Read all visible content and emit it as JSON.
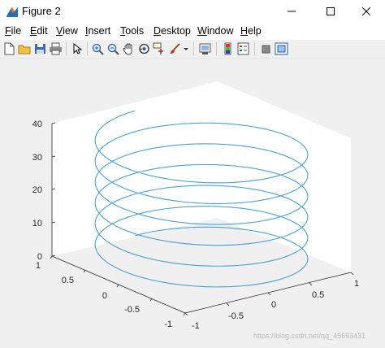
{
  "window": {
    "title": "Figure 2",
    "icon": "matlab-figure-icon",
    "controls": [
      "minimize-icon",
      "maximize-icon",
      "close-icon"
    ]
  },
  "menu": [
    {
      "label": "File",
      "key": "F"
    },
    {
      "label": "Edit",
      "key": "E"
    },
    {
      "label": "View",
      "key": "V"
    },
    {
      "label": "Insert",
      "key": "I"
    },
    {
      "label": "Tools",
      "key": "T"
    },
    {
      "label": "Desktop",
      "key": "D"
    },
    {
      "label": "Window",
      "key": "W"
    },
    {
      "label": "Help",
      "key": "H"
    }
  ],
  "toolbar": [
    "new-figure-icon",
    "open-file-icon",
    "save-icon",
    "print-icon",
    "edit-plot-arrow-icon",
    "zoom-in-icon",
    "zoom-out-icon",
    "pan-hand-icon",
    "rotate-3d-icon",
    "data-cursor-icon",
    "brush-icon",
    "brush-dropdown-icon",
    "link-plot-icon",
    "insert-colorbar-icon",
    "insert-legend-icon",
    "hide-plot-tools-icon",
    "show-plot-tools-icon"
  ],
  "axes": {
    "z_ticks": [
      "0",
      "10",
      "20",
      "30",
      "40"
    ],
    "x_ticks": [
      "-1",
      "-0.5",
      "0",
      "0.5",
      "1"
    ],
    "y_ticks": [
      "-1",
      "-0.5",
      "0",
      "0.5",
      "1"
    ]
  },
  "chart_data": {
    "type": "line",
    "plot_kind": "3d-helix",
    "x": "sin(t)",
    "y": "cos(t)",
    "z": "t",
    "t_range": [
      0,
      37.7
    ],
    "xlim": [
      -1,
      1
    ],
    "ylim": [
      -1,
      1
    ],
    "zlim": [
      0,
      40
    ],
    "view": "default-3d",
    "grid": false,
    "line_color": "#4a9fd4",
    "panel_color": "#ffffff"
  },
  "watermark": "https://blog.csdn.net/qq_45693431"
}
